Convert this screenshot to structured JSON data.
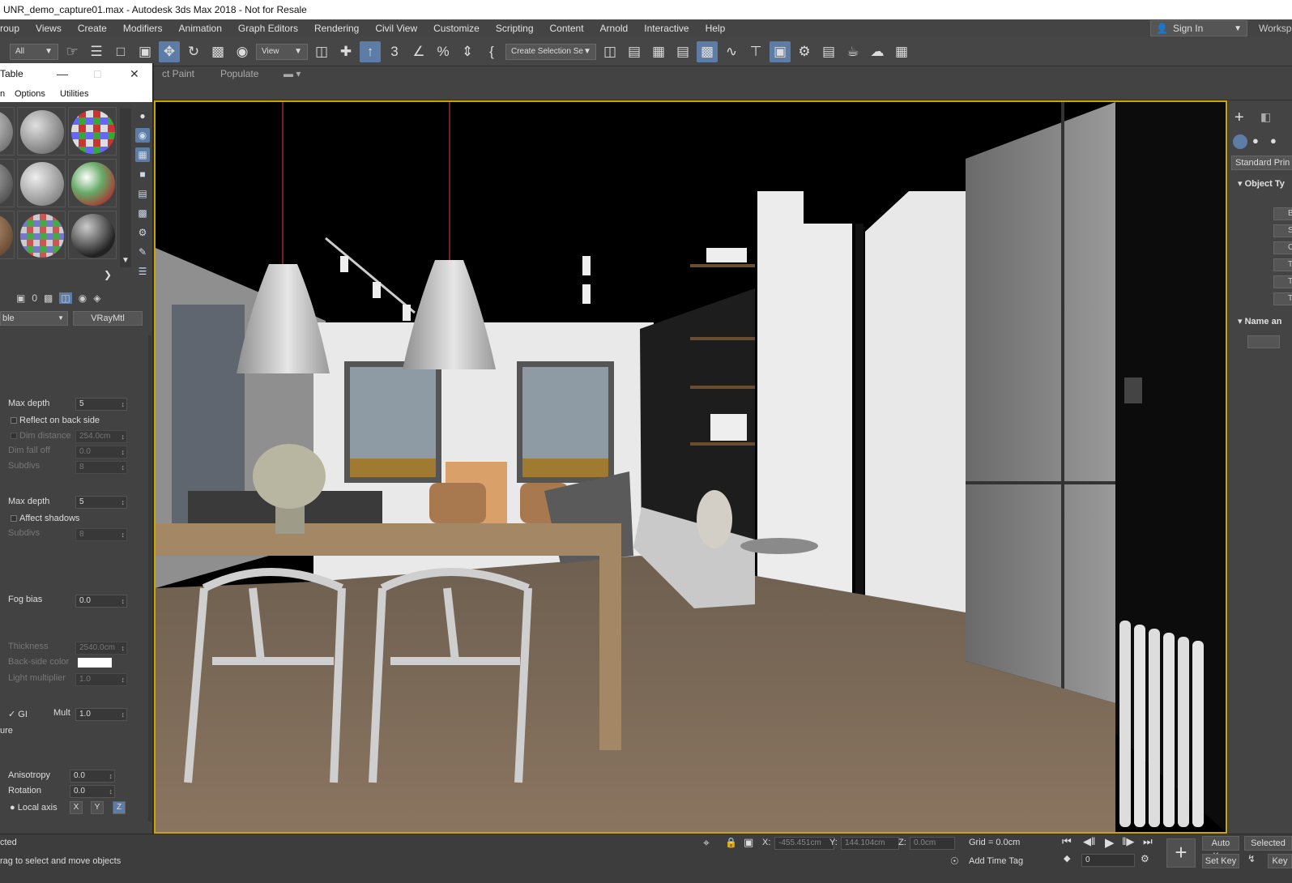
{
  "window": {
    "title": "UNR_demo_capture01.max - Autodesk 3ds Max 2018 - Not for Resale"
  },
  "menu": {
    "items": [
      "roup",
      "Views",
      "Create",
      "Modifiers",
      "Animation",
      "Graph Editors",
      "Rendering",
      "Civil View",
      "Customize",
      "Scripting",
      "Content",
      "Arnold",
      "Interactive",
      "Help"
    ],
    "sign_in": "Sign In",
    "workspace": "Worksp"
  },
  "toolbar": {
    "filter_value": "All",
    "ref_coord_value": "View",
    "selection_set_placeholder": "Create Selection Se"
  },
  "ribbon": {
    "tab_paint": "ct Paint",
    "tab_populate": "Populate"
  },
  "command_panel": {
    "category_value": "Standard Prin",
    "rollout_object_type": "Object Ty",
    "object_buttons": [
      "B",
      "Sp",
      "Cy",
      "To",
      "Te",
      "Tex"
    ],
    "rollout_name": "Name an"
  },
  "material_editor": {
    "title": "Table",
    "menu": [
      "n",
      "Options",
      "Utilities"
    ],
    "mat_name": "ble",
    "mat_type": "VRayMtl",
    "params": {
      "refl_max_depth_label": "Max depth",
      "refl_max_depth": "5",
      "reflect_back_label": "Reflect on back side",
      "dim_distance_label": "Dim distance",
      "dim_distance": "254.0cm",
      "dim_falloff_label": "Dim fall off",
      "dim_falloff": "0.0",
      "refl_subdivs_label": "Subdivs",
      "refl_subdivs": "8",
      "refr_max_depth_label": "Max depth",
      "refr_max_depth": "5",
      "affect_shadows_label": "Affect shadows",
      "refr_subdivs_label": "Subdivs",
      "refr_subdivs": "8",
      "fog_bias_label": "Fog bias",
      "fog_bias": "0.0",
      "thickness_label": "Thickness",
      "thickness": "2540.0cm",
      "backside_color_label": "Back-side color",
      "light_mult_label": "Light multiplier",
      "light_mult": "1.0",
      "gi_label": "GI",
      "mult_label": "Mult",
      "mult": "1.0",
      "ure_label": "ure",
      "anisotropy_label": "Anisotropy",
      "anisotropy": "0.0",
      "rotation_label": "Rotation",
      "rotation": "0.0",
      "local_axis_label": "Local axis",
      "axis_x": "X",
      "axis_y": "Y",
      "axis_z": "Z"
    }
  },
  "status": {
    "selected_text": "cted",
    "prompt": "rag to select and move objects",
    "x_label": "X:",
    "x_value": "-455.451cm",
    "y_label": "Y:",
    "y_value": "144.104cm",
    "z_label": "Z:",
    "z_value": "0.0cm",
    "grid": "Grid = 0.0cm",
    "add_time_tag": "Add Time Tag",
    "frame_value": "0",
    "auto_key": "Auto Key",
    "selected_dropdown": "Selected",
    "set_key": "Set Key",
    "key_filters": "Key"
  },
  "colors": {
    "viewport_border": "#c9a600",
    "active_tool": "#5d7da6",
    "floor": "#7d6b58"
  }
}
